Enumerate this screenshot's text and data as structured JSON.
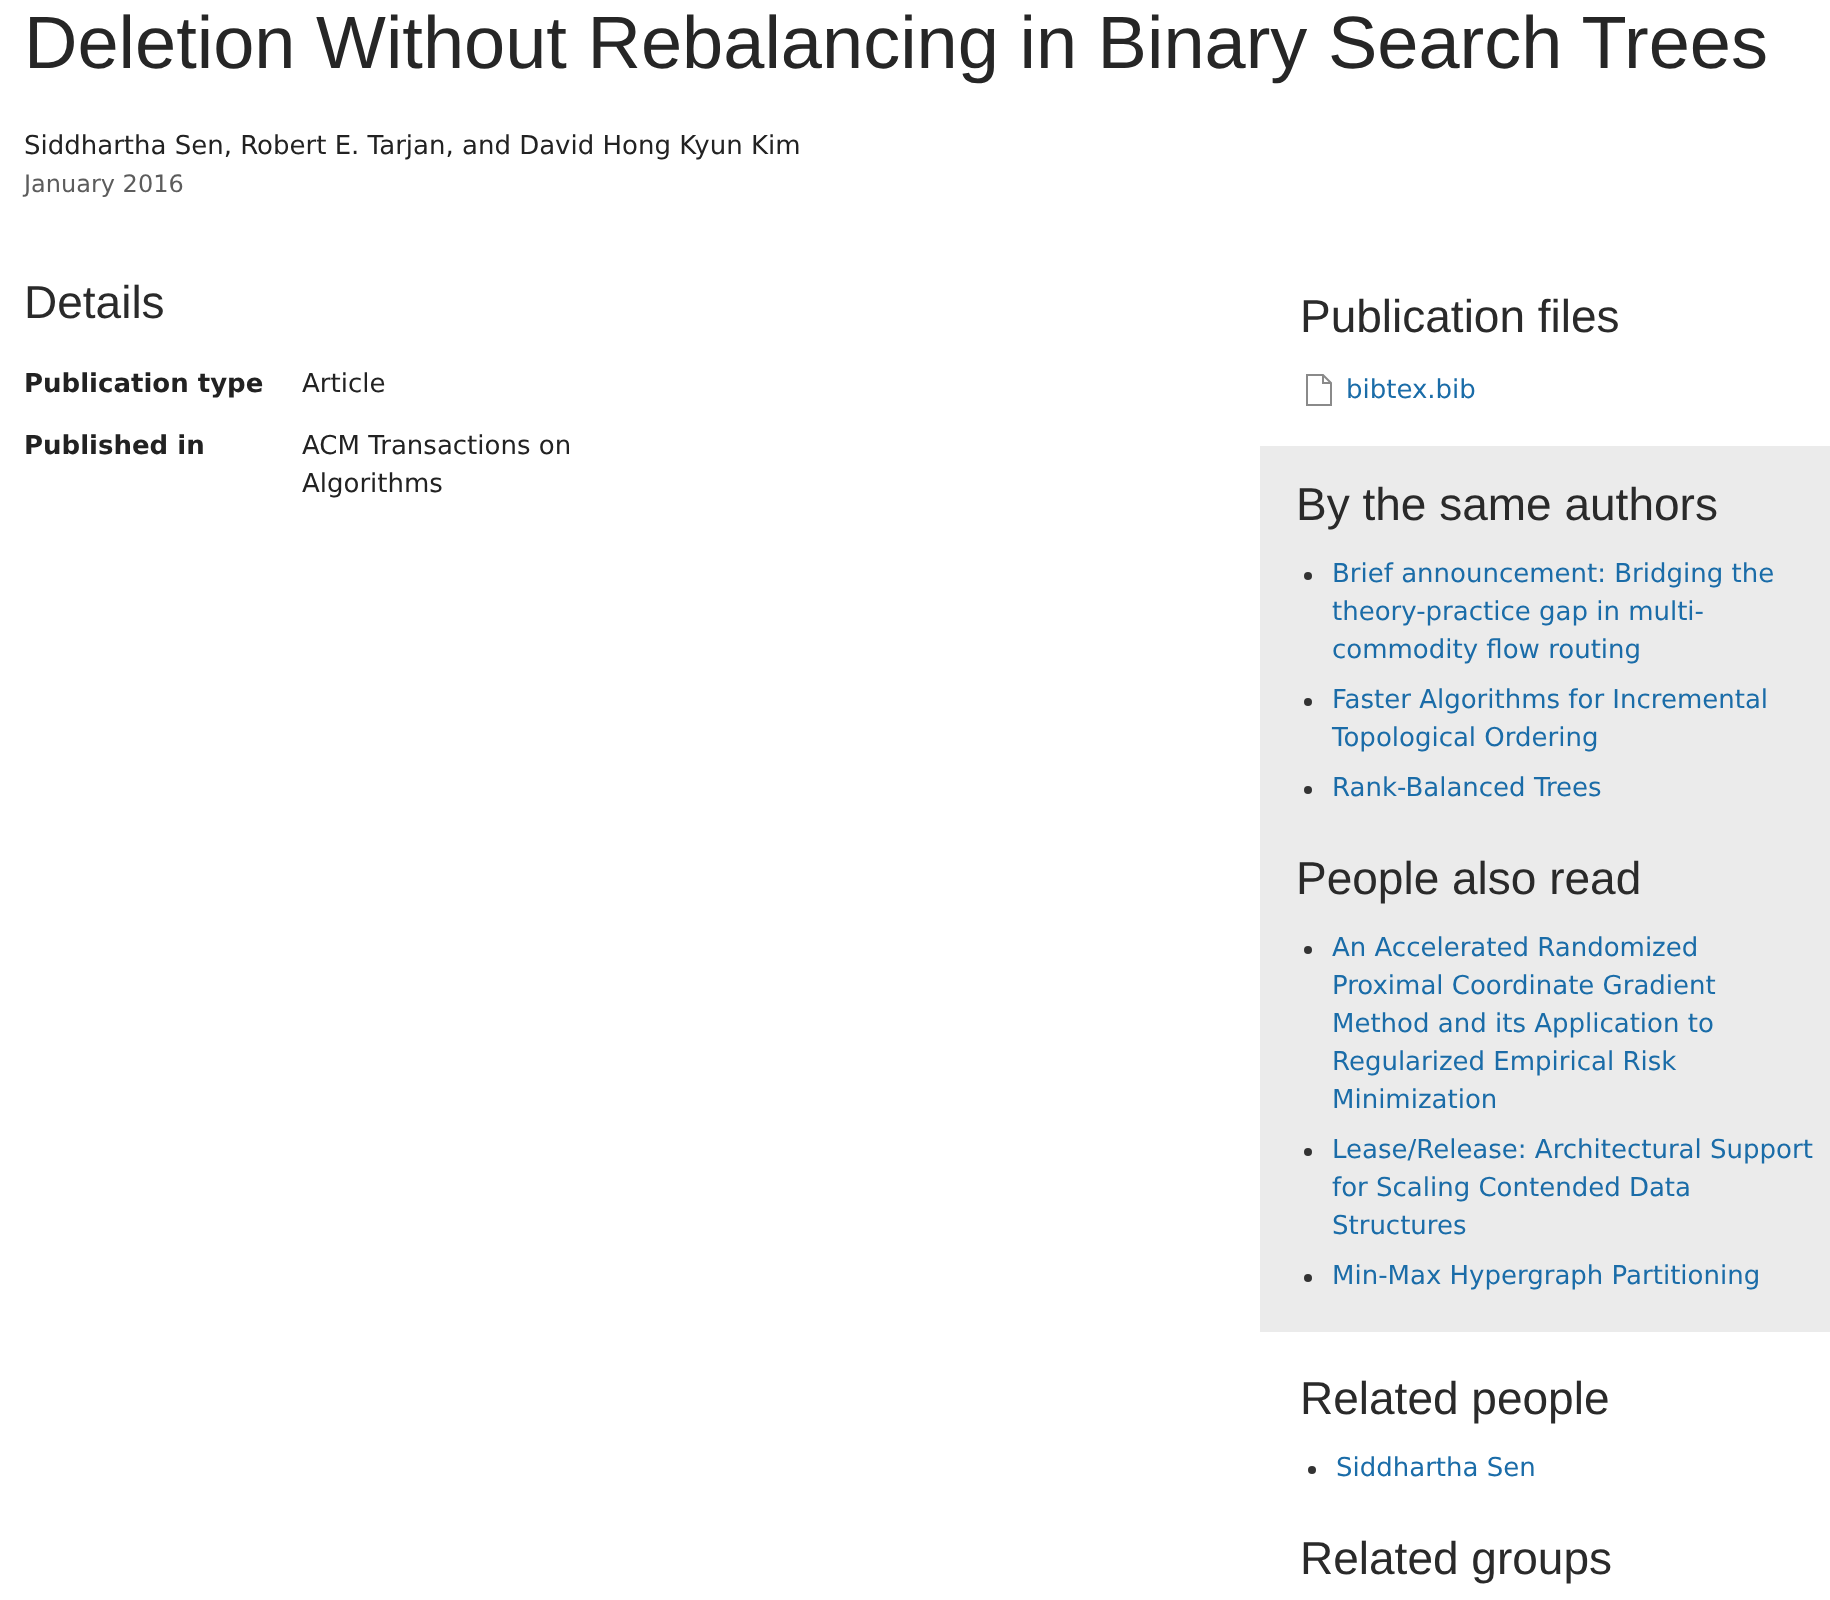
{
  "title": "Deletion Without Rebalancing in Binary Search Trees",
  "authors": "Siddhartha Sen, Robert E. Tarjan, and David Hong Kyun Kim",
  "date": "January 2016",
  "details": {
    "heading": "Details",
    "rows": [
      {
        "label": "Publication type",
        "value": "Article"
      },
      {
        "label": "Published in",
        "value": "ACM Transactions on Algorithms"
      }
    ]
  },
  "sidebar": [
    {
      "heading": "Publication files",
      "kind": "files",
      "shaded": false,
      "items": [
        "bibtex.bib"
      ]
    },
    {
      "heading": "By the same authors",
      "kind": "publications",
      "shaded": true,
      "items": [
        "Brief announcement: Bridging the theory-practice gap in multi-commodity flow routing",
        "Faster Algorithms for Incremental Topological Ordering",
        "Rank-Balanced Trees"
      ]
    },
    {
      "heading": "People also read",
      "kind": "publications",
      "shaded": true,
      "items": [
        "An Accelerated Randomized Proximal Coordinate Gradient Method and its Application to Regularized Empirical Risk Minimization",
        "Lease/Release: Architectural Support for Scaling Contended Data Structures",
        "Min-Max Hypergraph Partitioning"
      ]
    },
    {
      "heading": "Related people",
      "kind": "people",
      "shaded": false,
      "items": [
        "Siddhartha Sen"
      ]
    },
    {
      "heading": "Related groups",
      "kind": "groups",
      "shaded": false
    }
  ]
}
